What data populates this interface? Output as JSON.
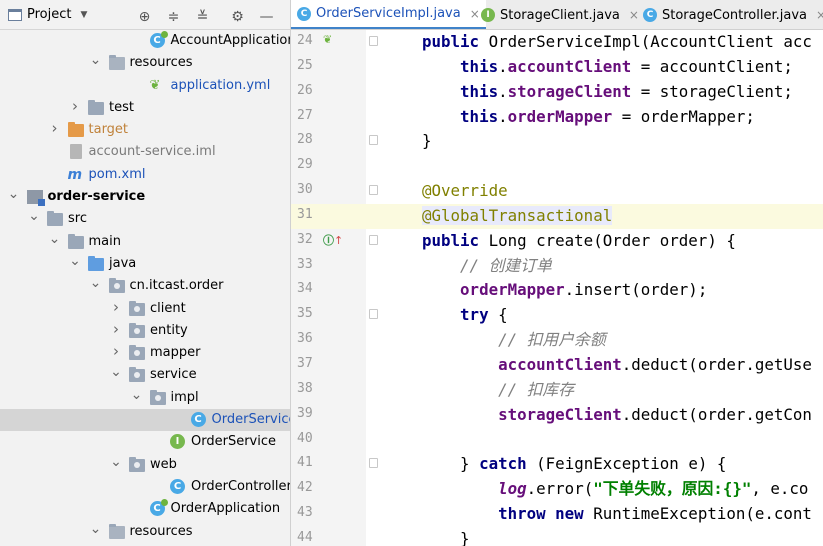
{
  "project_panel": {
    "title": "Project",
    "tree": [
      {
        "label": "AccountApplication",
        "icon": "spring-boot-class-icon",
        "depth": 7,
        "arrow": "",
        "name": "tree-item-account-application"
      },
      {
        "label": "resources",
        "icon": "resources-folder-icon",
        "depth": 5,
        "arrow": "expanded",
        "name": "tree-item-resources"
      },
      {
        "label": "application.yml",
        "icon": "yaml-leaf-icon",
        "depth": 7,
        "arrow": "",
        "name": "tree-item-application-yml",
        "color": "#1c52b8"
      },
      {
        "label": "test",
        "icon": "folder-icon",
        "depth": 4,
        "arrow": "collapsed",
        "name": "tree-item-test"
      },
      {
        "label": "target",
        "icon": "excluded-folder-icon",
        "depth": 3,
        "arrow": "collapsed",
        "name": "tree-item-target",
        "color": "#c0823a"
      },
      {
        "label": "account-service.iml",
        "icon": "iml-file-icon",
        "depth": 3,
        "arrow": "",
        "name": "tree-item-account-service-iml",
        "color": "#7a7a7a"
      },
      {
        "label": "pom.xml",
        "icon": "maven-icon",
        "depth": 3,
        "arrow": "",
        "name": "tree-item-pom-xml",
        "color": "#1c52b8"
      },
      {
        "label": "order-service",
        "icon": "module-icon",
        "depth": 1,
        "arrow": "expanded",
        "name": "tree-item-order-service",
        "bold": true
      },
      {
        "label": "src",
        "icon": "folder-icon",
        "depth": 2,
        "arrow": "expanded",
        "name": "tree-item-src"
      },
      {
        "label": "main",
        "icon": "folder-icon",
        "depth": 3,
        "arrow": "expanded",
        "name": "tree-item-main"
      },
      {
        "label": "java",
        "icon": "source-folder-icon",
        "depth": 4,
        "arrow": "expanded",
        "name": "tree-item-java"
      },
      {
        "label": "cn.itcast.order",
        "icon": "package-icon",
        "depth": 5,
        "arrow": "expanded",
        "name": "tree-item-package-order"
      },
      {
        "label": "client",
        "icon": "package-icon",
        "depth": 6,
        "arrow": "collapsed",
        "name": "tree-item-client"
      },
      {
        "label": "entity",
        "icon": "package-icon",
        "depth": 6,
        "arrow": "collapsed",
        "name": "tree-item-entity"
      },
      {
        "label": "mapper",
        "icon": "package-icon",
        "depth": 6,
        "arrow": "collapsed",
        "name": "tree-item-mapper"
      },
      {
        "label": "service",
        "icon": "package-icon",
        "depth": 6,
        "arrow": "expanded",
        "name": "tree-item-service"
      },
      {
        "label": "impl",
        "icon": "package-icon",
        "depth": 7,
        "arrow": "expanded",
        "name": "tree-item-impl"
      },
      {
        "label": "OrderService",
        "icon": "class-icon",
        "depth": 9,
        "arrow": "",
        "name": "tree-item-order-service-impl",
        "selected": true,
        "color": "#1c52b8"
      },
      {
        "label": "OrderService",
        "icon": "interface-icon",
        "depth": 8,
        "arrow": "",
        "name": "tree-item-order-service-interface"
      },
      {
        "label": "web",
        "icon": "package-icon",
        "depth": 6,
        "arrow": "expanded",
        "name": "tree-item-web"
      },
      {
        "label": "OrderController",
        "icon": "class-icon",
        "depth": 8,
        "arrow": "",
        "name": "tree-item-order-controller"
      },
      {
        "label": "OrderApplication",
        "icon": "spring-boot-class-icon",
        "depth": 7,
        "arrow": "",
        "name": "tree-item-order-application"
      },
      {
        "label": "resources",
        "icon": "resources-folder-icon",
        "depth": 5,
        "arrow": "expanded",
        "name": "tree-item-resources-2"
      }
    ]
  },
  "tabs": [
    {
      "label": "OrderServiceImpl.java",
      "icon": "class-icon",
      "active": true,
      "name": "tab-order-service-impl"
    },
    {
      "label": "StorageClient.java",
      "icon": "interface-icon",
      "active": false,
      "name": "tab-storage-client"
    },
    {
      "label": "StorageController.java",
      "icon": "class-icon",
      "active": false,
      "name": "tab-storage-controller"
    }
  ],
  "editor": {
    "lines": [
      {
        "num": "24",
        "mark": "bean",
        "fold": true,
        "tokens": [
          [
            "kw",
            "public "
          ],
          [
            "",
            "OrderServiceImpl(AccountClient acc"
          ]
        ]
      },
      {
        "num": "25",
        "tokens": [
          [
            "",
            "    "
          ],
          [
            "kw",
            "this"
          ],
          [
            "",
            "."
          ],
          [
            "fld",
            "accountClient"
          ],
          [
            "",
            " = accountClient;"
          ]
        ]
      },
      {
        "num": "26",
        "tokens": [
          [
            "",
            "    "
          ],
          [
            "kw",
            "this"
          ],
          [
            "",
            "."
          ],
          [
            "fld",
            "storageClient"
          ],
          [
            "",
            " = storageClient;"
          ]
        ]
      },
      {
        "num": "27",
        "tokens": [
          [
            "",
            "    "
          ],
          [
            "kw",
            "this"
          ],
          [
            "",
            "."
          ],
          [
            "fld",
            "orderMapper"
          ],
          [
            "",
            " = orderMapper;"
          ]
        ]
      },
      {
        "num": "28",
        "fold": true,
        "tokens": [
          [
            "",
            "}"
          ]
        ]
      },
      {
        "num": "29",
        "tokens": []
      },
      {
        "num": "30",
        "fold": true,
        "tokens": [
          [
            "ann",
            "@Override"
          ]
        ]
      },
      {
        "num": "31",
        "current": true,
        "fold": true,
        "tokens": [
          [
            "ann hl",
            "@GlobalTransactional"
          ]
        ]
      },
      {
        "num": "32",
        "mark": "impl",
        "fold": true,
        "tokens": [
          [
            "kw",
            "public "
          ],
          [
            "",
            "Long create(Order order) {"
          ]
        ]
      },
      {
        "num": "33",
        "tokens": [
          [
            "",
            "    "
          ],
          [
            "cmt",
            "// 创建订单"
          ]
        ]
      },
      {
        "num": "34",
        "tokens": [
          [
            "",
            "    "
          ],
          [
            "fld",
            "orderMapper"
          ],
          [
            "",
            ".insert(order);"
          ]
        ]
      },
      {
        "num": "35",
        "fold": true,
        "tokens": [
          [
            "",
            "    "
          ],
          [
            "kw",
            "try "
          ],
          [
            "",
            "{"
          ]
        ]
      },
      {
        "num": "36",
        "tokens": [
          [
            "",
            "        "
          ],
          [
            "cmt",
            "// 扣用户余额"
          ]
        ]
      },
      {
        "num": "37",
        "tokens": [
          [
            "",
            "        "
          ],
          [
            "fld",
            "accountClient"
          ],
          [
            "",
            ".deduct(order.getUse"
          ]
        ]
      },
      {
        "num": "38",
        "tokens": [
          [
            "",
            "        "
          ],
          [
            "cmt",
            "// 扣库存"
          ]
        ]
      },
      {
        "num": "39",
        "tokens": [
          [
            "",
            "        "
          ],
          [
            "fld",
            "storageClient"
          ],
          [
            "",
            ".deduct(order.getCon"
          ]
        ]
      },
      {
        "num": "40",
        "tokens": []
      },
      {
        "num": "41",
        "fold": true,
        "tokens": [
          [
            "",
            "    } "
          ],
          [
            "kw",
            "catch "
          ],
          [
            "",
            "(FeignException e) {"
          ]
        ]
      },
      {
        "num": "42",
        "tokens": [
          [
            "",
            "        "
          ],
          [
            "logv",
            "log"
          ],
          [
            "",
            ".error("
          ],
          [
            "str",
            "\"下单失败，原因:{}\""
          ],
          [
            "",
            ", e.co"
          ]
        ]
      },
      {
        "num": "43",
        "tokens": [
          [
            "",
            "        "
          ],
          [
            "kw",
            "throw new "
          ],
          [
            "",
            "RuntimeException(e.cont"
          ]
        ]
      },
      {
        "num": "44",
        "tokens": [
          [
            "",
            "    }"
          ]
        ]
      }
    ]
  }
}
